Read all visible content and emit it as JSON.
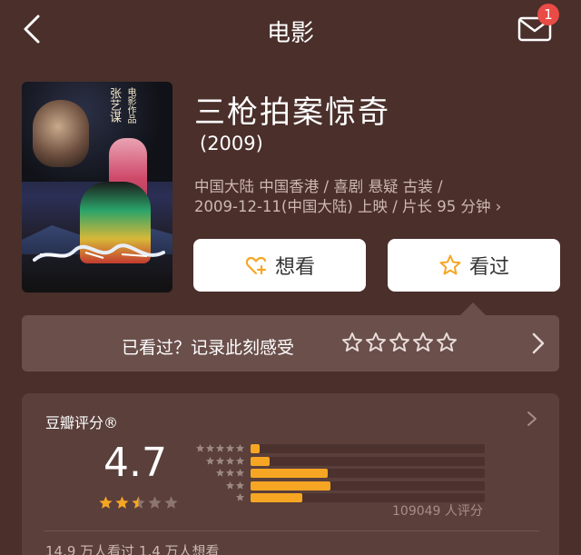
{
  "header": {
    "title": "电影",
    "back_icon": "chevron-left-icon",
    "mail_icon": "envelope-icon",
    "mail_badge": "1"
  },
  "movie": {
    "name": "三枪拍案惊奇",
    "year": "(2009)",
    "meta_line1": "中国大陆 中国香港 / 喜剧 悬疑 古装 /",
    "meta_line2": "2009-12-11(中国大陆) 上映 / 片长 95 分钟",
    "meta_chevron": "›",
    "poster": {
      "director_name": "张艺谋",
      "director_suffix": "电影作品"
    }
  },
  "actions": {
    "want_label": "想看",
    "seen_label": "看过"
  },
  "record": {
    "prompt": "已看过？记录此刻感受",
    "star_count": 5
  },
  "rating": {
    "label": "豆瓣评分®",
    "score": "4.7",
    "score_stars_value": 2.5,
    "distribution": [
      {
        "stars": 5,
        "fraction": 0.04
      },
      {
        "stars": 4,
        "fraction": 0.08
      },
      {
        "stars": 3,
        "fraction": 0.33
      },
      {
        "stars": 2,
        "fraction": 0.34
      },
      {
        "stars": 1,
        "fraction": 0.22
      }
    ],
    "count_text": "109049 人评分",
    "watch_stats": "14.9 万人看过   1.4 万人想看"
  },
  "colors": {
    "background": "#4a2f2b",
    "accent_star": "#f6a623",
    "badge": "#e94b46"
  }
}
